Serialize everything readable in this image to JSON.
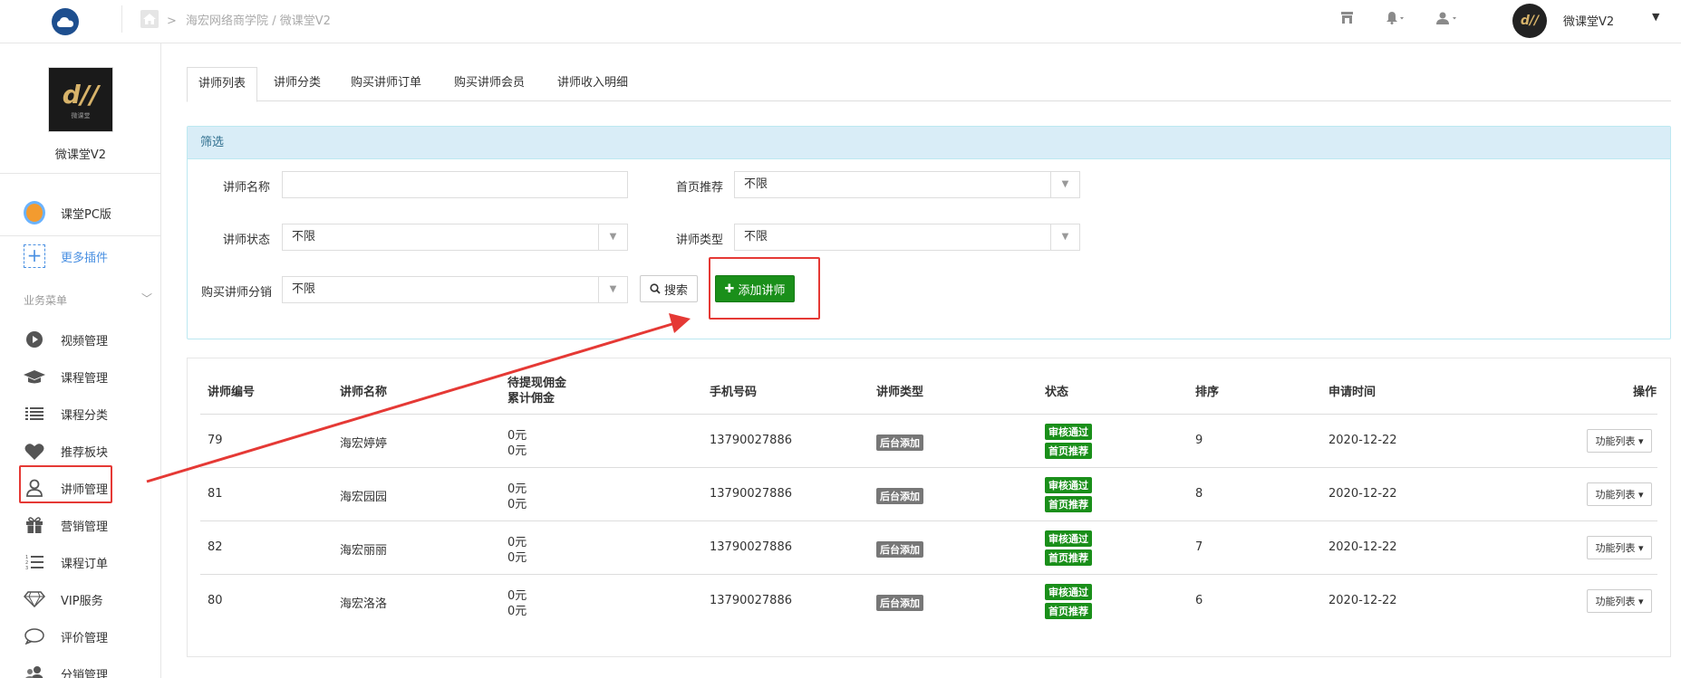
{
  "header": {
    "breadcrumb_root": "海宏网络商学院",
    "breadcrumb_sep": "/",
    "breadcrumb_current": "微课堂V2",
    "avatar_mark": "d//",
    "username": "微课堂V2"
  },
  "sidebar": {
    "avatar_mark": "d//",
    "avatar_sub": "微课堂",
    "name": "微课堂V2",
    "plugins": [
      {
        "label": "课堂PC版"
      },
      {
        "label": "更多插件"
      }
    ],
    "section_title": "业务菜单",
    "menu": [
      {
        "label": "视频管理",
        "icon": "play-icon"
      },
      {
        "label": "课程管理",
        "icon": "graduation-cap-icon"
      },
      {
        "label": "课程分类",
        "icon": "list-icon"
      },
      {
        "label": "推荐板块",
        "icon": "heart-icon"
      },
      {
        "label": "讲师管理",
        "icon": "teacher-icon"
      },
      {
        "label": "营销管理",
        "icon": "gift-icon"
      },
      {
        "label": "课程订单",
        "icon": "ordered-list-icon"
      },
      {
        "label": "VIP服务",
        "icon": "diamond-icon"
      },
      {
        "label": "评价管理",
        "icon": "comment-icon"
      },
      {
        "label": "分销管理",
        "icon": "users-icon"
      }
    ]
  },
  "tabs": [
    "讲师列表",
    "讲师分类",
    "购买讲师订单",
    "购买讲师会员",
    "讲师收入明细"
  ],
  "filter": {
    "title": "筛选",
    "name_label": "讲师名称",
    "name_value": "",
    "home_label": "首页推荐",
    "home_value": "不限",
    "status_label": "讲师状态",
    "status_value": "不限",
    "type_label": "讲师类型",
    "type_value": "不限",
    "dist_label": "购买讲师分销",
    "dist_value": "不限",
    "search_label": "搜索",
    "add_label": "添加讲师"
  },
  "table": {
    "headers": {
      "id": "讲师编号",
      "name": "讲师名称",
      "commission1": "待提现佣金",
      "commission2": "累计佣金",
      "phone": "手机号码",
      "type": "讲师类型",
      "status": "状态",
      "sort": "排序",
      "date": "申请时间",
      "ops": "操作"
    },
    "rows": [
      {
        "id": "79",
        "name": "海宏婷婷",
        "pending": "0元",
        "total": "0元",
        "phone": "13790027886",
        "type": "后台添加",
        "status1": "审核通过",
        "status2": "首页推荐",
        "sort": "9",
        "date": "2020-12-22",
        "ops": "功能列表"
      },
      {
        "id": "81",
        "name": "海宏园园",
        "pending": "0元",
        "total": "0元",
        "phone": "13790027886",
        "type": "后台添加",
        "status1": "审核通过",
        "status2": "首页推荐",
        "sort": "8",
        "date": "2020-12-22",
        "ops": "功能列表"
      },
      {
        "id": "82",
        "name": "海宏丽丽",
        "pending": "0元",
        "total": "0元",
        "phone": "13790027886",
        "type": "后台添加",
        "status1": "审核通过",
        "status2": "首页推荐",
        "sort": "7",
        "date": "2020-12-22",
        "ops": "功能列表"
      },
      {
        "id": "80",
        "name": "海宏洛洛",
        "pending": "0元",
        "total": "0元",
        "phone": "13790027886",
        "type": "后台添加",
        "status1": "审核通过",
        "status2": "首页推荐",
        "sort": "6",
        "date": "2020-12-22",
        "ops": "功能列表"
      }
    ]
  },
  "colors": {
    "accent_green": "#1a8f1a",
    "panel_blue": "#d9edf7",
    "annotation_red": "#e53935",
    "link_blue": "#4a90e2"
  }
}
